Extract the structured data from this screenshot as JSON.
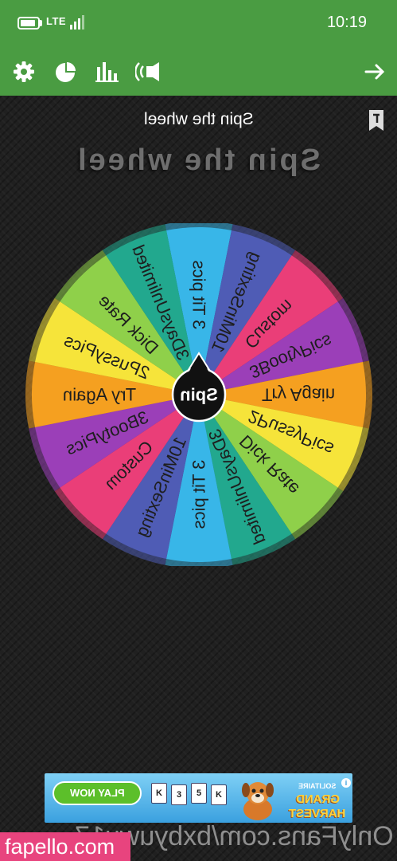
{
  "status_bar": {
    "network": "LTE",
    "time": "10:19"
  },
  "toolbar": {
    "icons": [
      "gear-icon",
      "pie-chart-icon",
      "bar-chart-icon",
      "sound-icon",
      "arrow-right-icon"
    ]
  },
  "header": {
    "title": "Spin the wheel",
    "bookmark_icon": "bookmark-icon"
  },
  "wheel": {
    "title": "Spin the wheel",
    "button_label": "Spin",
    "segments": [
      {
        "label": "3 Tit pics",
        "color": "#38b6e8"
      },
      {
        "label": "10MinSexting",
        "color": "#4f5cb5"
      },
      {
        "label": "Custom",
        "color": "#ea3e78"
      },
      {
        "label": "3BootyPics",
        "color": "#9b3fb8"
      },
      {
        "label": "Try Again",
        "color": "#f5a020"
      },
      {
        "label": "2PussyPics",
        "color": "#f6e43a"
      },
      {
        "label": "Dick Rate",
        "color": "#8fd04a"
      },
      {
        "label": "3DaysUnlimited",
        "color": "#22a88e"
      },
      {
        "label": "3 Tit pics",
        "color": "#38b6e8"
      },
      {
        "label": "10MinSexting",
        "color": "#4f5cb5"
      },
      {
        "label": "Custom",
        "color": "#ea3e78"
      },
      {
        "label": "3BootyPics",
        "color": "#9b3fb8"
      },
      {
        "label": "Try Again",
        "color": "#f5a020"
      },
      {
        "label": "2PussyPics",
        "color": "#f6e43a"
      },
      {
        "label": "Dick Rate",
        "color": "#8fd04a"
      },
      {
        "label": "3DaysUnlimited",
        "color": "#22a88e"
      }
    ]
  },
  "ad": {
    "play_label": "PLAY NOW",
    "cards": [
      "K",
      "3",
      "5",
      "K"
    ],
    "brand_small": "SOLITAIRE",
    "brand_big_1": "GRAND",
    "brand_big_2": "HARVEST",
    "info": "i"
  },
  "watermark": "OnlyFans.com/bxbyuwu17",
  "site_badge": "fapello.com",
  "colors": {
    "accent_green": "#4a9c42",
    "badge_pink": "#e8447e"
  }
}
